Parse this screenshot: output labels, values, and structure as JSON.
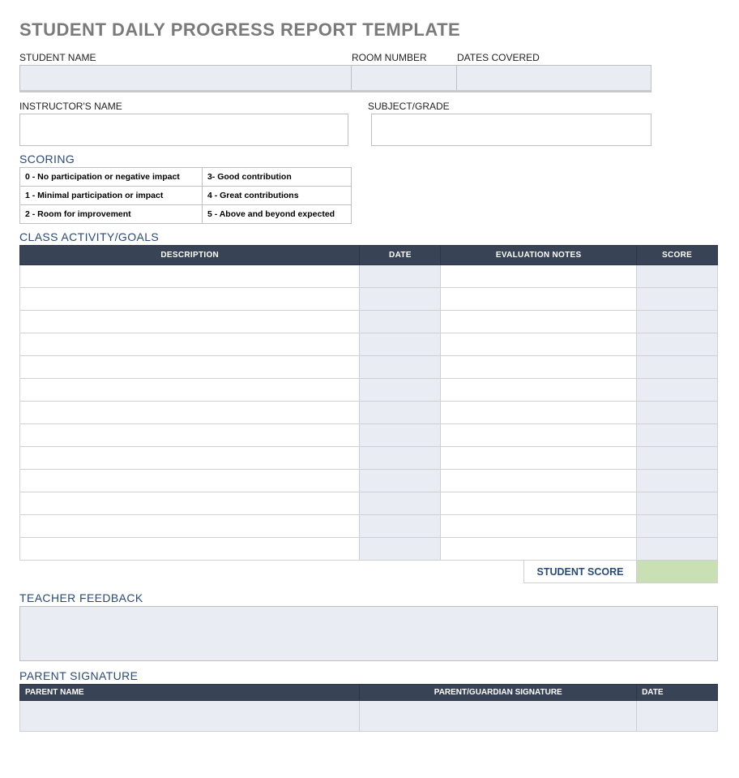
{
  "title": "STUDENT DAILY PROGRESS REPORT TEMPLATE",
  "fields": {
    "student_name_label": "STUDENT NAME",
    "room_number_label": "ROOM NUMBER",
    "dates_covered_label": "DATES COVERED",
    "instructor_name_label": "INSTRUCTOR'S NAME",
    "subject_grade_label": "SUBJECT/GRADE"
  },
  "scoring": {
    "heading": "SCORING",
    "rows": [
      {
        "left": "0 - No participation or negative impact",
        "right": "3- Good contribution"
      },
      {
        "left": "1 - Minimal participation or impact",
        "right": "4 - Great contributions"
      },
      {
        "left": "2 - Room for improvement",
        "right": "5 - Above and beyond expected"
      }
    ]
  },
  "activity": {
    "heading": "CLASS ACTIVITY/GOALS",
    "headers": {
      "description": "DESCRIPTION",
      "date": "DATE",
      "evaluation": "EVALUATION NOTES",
      "score": "SCORE"
    },
    "row_count": 13,
    "student_score_label": "STUDENT SCORE"
  },
  "feedback": {
    "heading": "TEACHER FEEDBACK"
  },
  "parent": {
    "heading": "PARENT SIGNATURE",
    "headers": {
      "name": "PARENT NAME",
      "signature": "PARENT/GUARDIAN SIGNATURE",
      "date": "DATE"
    }
  }
}
